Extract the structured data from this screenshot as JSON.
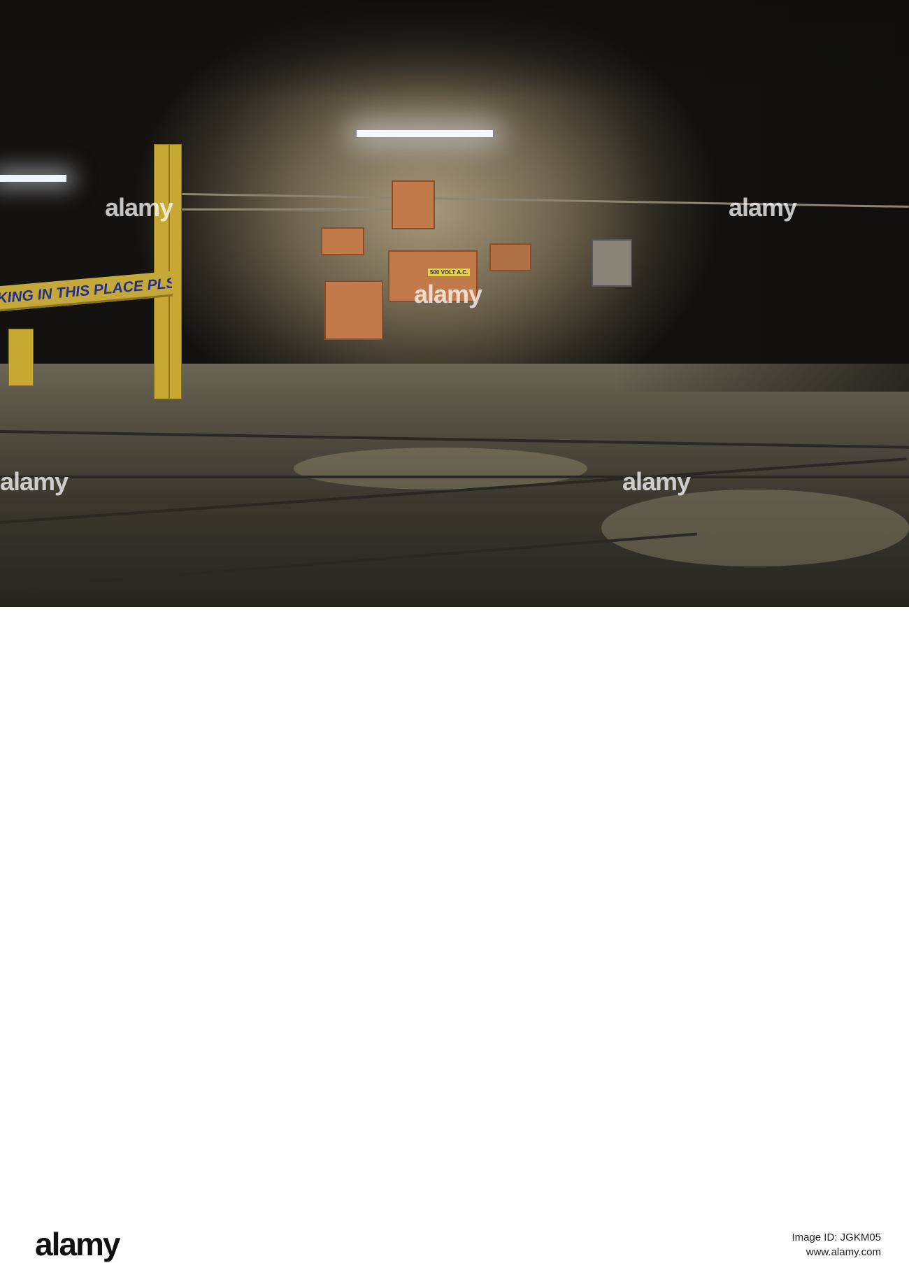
{
  "photo": {
    "description_alt": "Underground mine tunnel with electrical boxes",
    "sign_text": "KING IN THIS PLACE PLS!!",
    "panel_label": "500 VOLT A.C.",
    "watermark": "alamy"
  },
  "footer": {
    "logo": "alamy",
    "image_id": "Image ID: JGKM05",
    "url": "www.alamy.com"
  }
}
